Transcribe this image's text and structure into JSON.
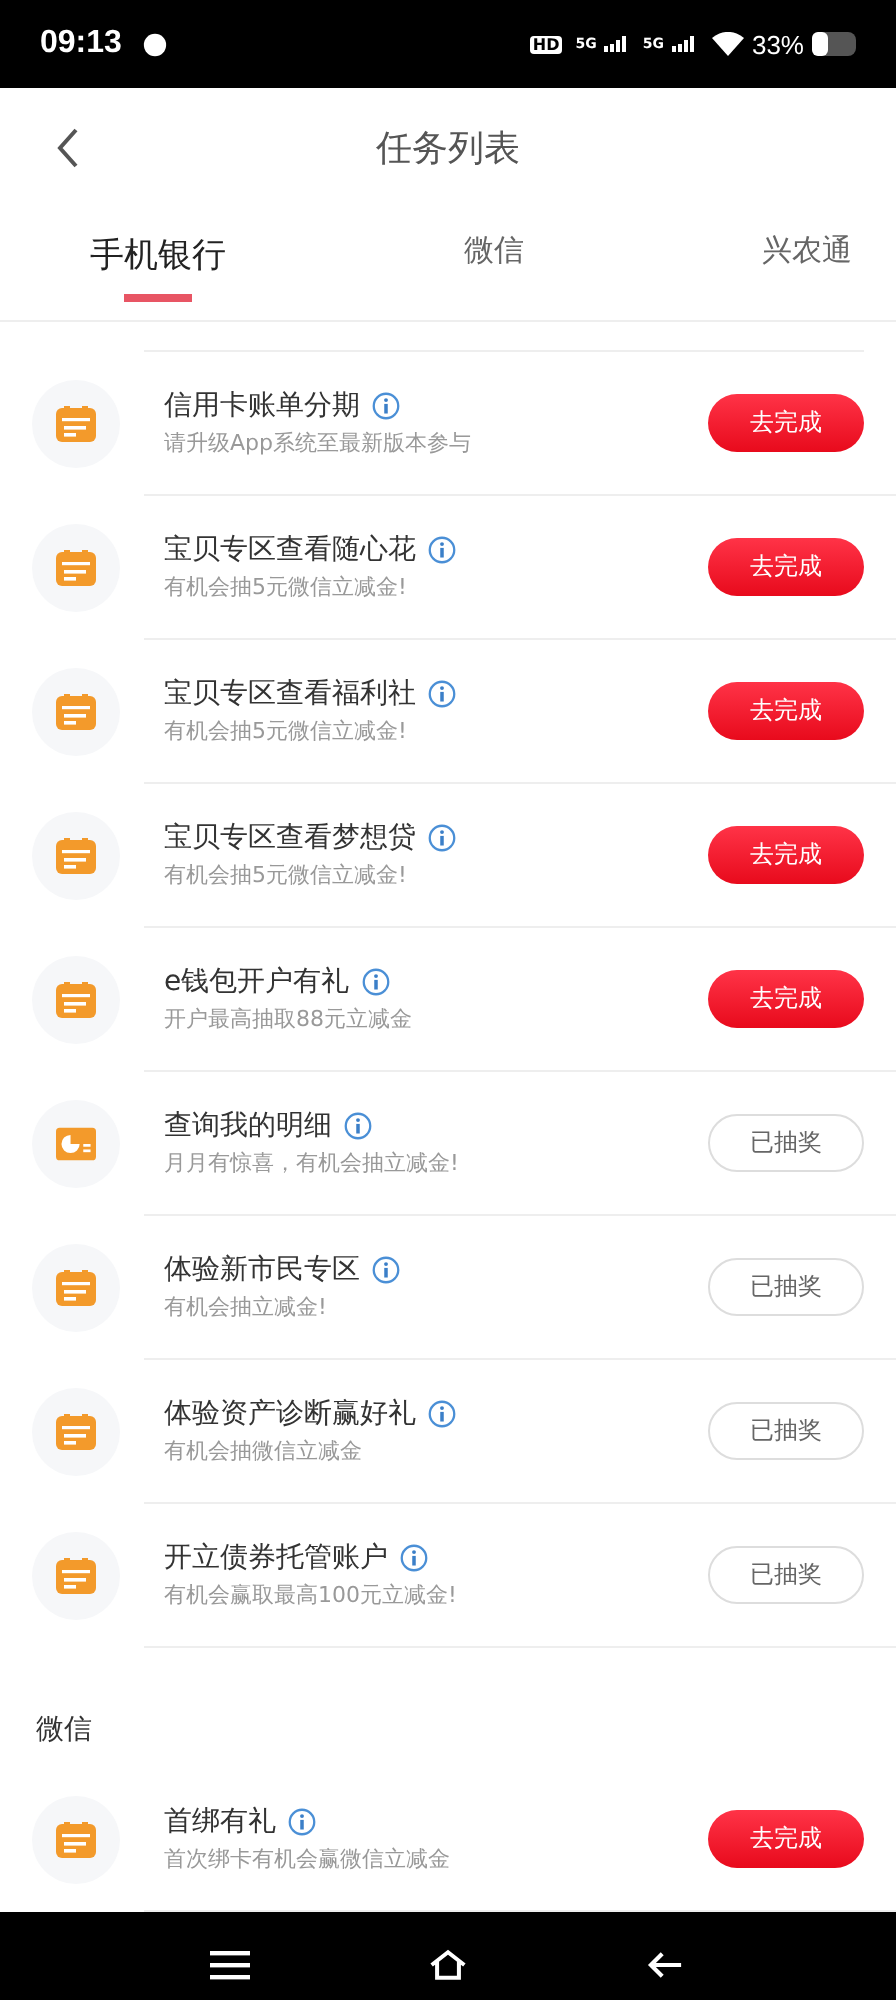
{
  "status_bar": {
    "time": "09:13",
    "hd": "HD",
    "networks": [
      "5G",
      "5G"
    ],
    "battery": "33%"
  },
  "header": {
    "title": "任务列表"
  },
  "tabs": [
    {
      "label": "手机银行",
      "selected": true
    },
    {
      "label": "微信",
      "selected": false
    },
    {
      "label": "兴农通",
      "selected": false
    }
  ],
  "sections": [
    {
      "tasks": [
        {
          "kind": "calendar",
          "title": "信用卡账单分期",
          "subtitle": "请升级App系统至最新版本参与",
          "drawn": false,
          "button": "去完成"
        },
        {
          "kind": "calendar",
          "title": "宝贝专区查看随心花",
          "subtitle": "有机会抽5元微信立减金!",
          "drawn": false,
          "button": "去完成"
        },
        {
          "kind": "calendar",
          "title": "宝贝专区查看福利社",
          "subtitle": "有机会抽5元微信立减金!",
          "drawn": false,
          "button": "去完成"
        },
        {
          "kind": "calendar",
          "title": "宝贝专区查看梦想贷",
          "subtitle": "有机会抽5元微信立减金!",
          "drawn": false,
          "button": "去完成"
        },
        {
          "kind": "calendar",
          "title": "e钱包开户有礼",
          "subtitle": "开户最高抽取88元立减金",
          "drawn": false,
          "button": "去完成"
        },
        {
          "kind": "chart",
          "title": "查询我的明细",
          "subtitle": "月月有惊喜，有机会抽立减金!",
          "drawn": true,
          "button": "已抽奖"
        },
        {
          "kind": "calendar",
          "title": "体验新市民专区",
          "subtitle": "有机会抽立减金!",
          "drawn": true,
          "button": "已抽奖"
        },
        {
          "kind": "calendar",
          "title": "体验资产诊断赢好礼",
          "subtitle": "有机会抽微信立减金",
          "drawn": true,
          "button": "已抽奖"
        },
        {
          "kind": "calendar",
          "title": "开立债券托管账户",
          "subtitle": "有机会赢取最高100元立减金!",
          "drawn": true,
          "button": "已抽奖"
        }
      ]
    },
    {
      "title": "微信",
      "tasks": [
        {
          "kind": "calendar",
          "title": "首绑有礼",
          "subtitle": "首次绑卡有机会赢微信立减金",
          "drawn": false,
          "button": "去完成"
        }
      ]
    }
  ]
}
